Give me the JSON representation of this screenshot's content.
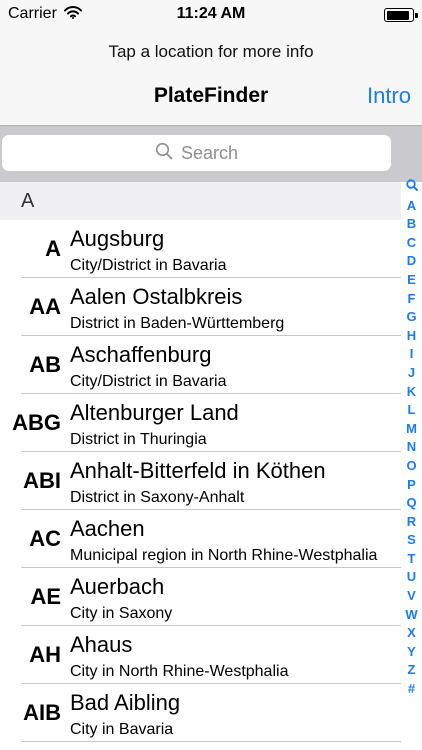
{
  "status_bar": {
    "carrier": "Carrier",
    "time": "11:24 AM",
    "icons": [
      "wifi-icon",
      "battery-icon"
    ],
    "battery_level": 0.9
  },
  "nav": {
    "prompt": "Tap a location for more info",
    "title": "PlateFinder",
    "intro_label": "Intro"
  },
  "search": {
    "placeholder": "Search",
    "icon": "search-icon"
  },
  "section": {
    "header": "A"
  },
  "rows": [
    {
      "code": "A",
      "name": "Augsburg",
      "description": "City/District in Bavaria"
    },
    {
      "code": "AA",
      "name": "Aalen Ostalbkreis",
      "description": "District in Baden-Württemberg"
    },
    {
      "code": "AB",
      "name": "Aschaffenburg",
      "description": "City/District in Bavaria"
    },
    {
      "code": "ABG",
      "name": "Altenburger Land",
      "description": "District in Thuringia"
    },
    {
      "code": "ABI",
      "name": "Anhalt-Bitterfeld in Köthen",
      "description": "District in Saxony-Anhalt"
    },
    {
      "code": "AC",
      "name": "Aachen",
      "description": "Municipal region in North Rhine-Westphalia"
    },
    {
      "code": "AE",
      "name": "Auerbach",
      "description": "City in Saxony"
    },
    {
      "code": "AH",
      "name": "Ahaus",
      "description": "City in North Rhine-Westphalia"
    },
    {
      "code": "AIB",
      "name": "Bad Aibling",
      "description": "City in Bavaria"
    }
  ],
  "index": [
    "A",
    "B",
    "C",
    "D",
    "E",
    "F",
    "G",
    "H",
    "I",
    "J",
    "K",
    "L",
    "M",
    "N",
    "O",
    "P",
    "Q",
    "R",
    "S",
    "T",
    "U",
    "V",
    "W",
    "X",
    "Y",
    "Z",
    "#"
  ],
  "colors": {
    "accent": "#1a7cf5",
    "bar_background": "#f7f7f7",
    "search_background": "#c9c9ce",
    "section_background": "#f0f0f3"
  }
}
